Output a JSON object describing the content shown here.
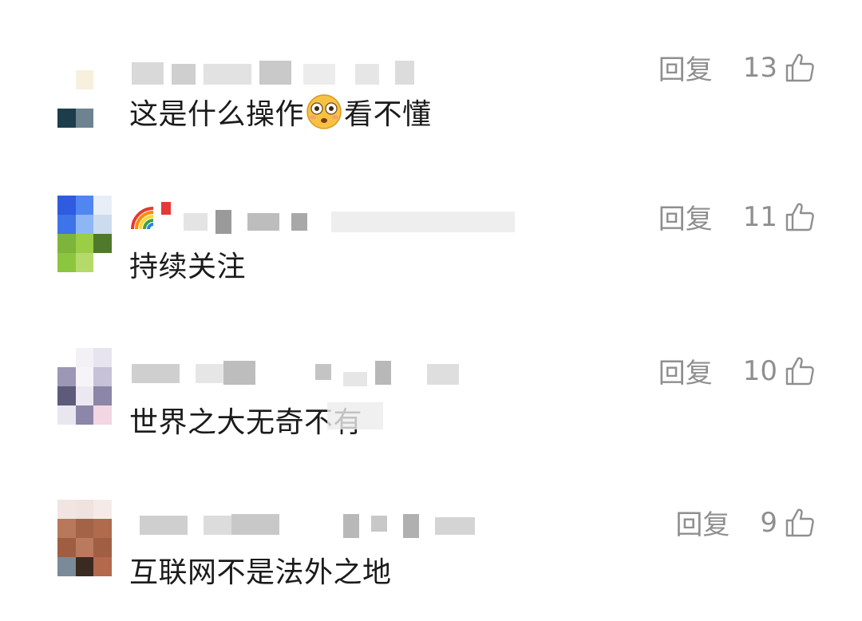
{
  "comments": [
    {
      "text_before": "这是什么操作",
      "emoji": "flushed-face-emoji",
      "text_after": "看不懂",
      "reply_label": "回复",
      "likes": "13"
    },
    {
      "text_before": "持续关注",
      "emoji": "",
      "text_after": "",
      "reply_label": "回复",
      "likes": "11"
    },
    {
      "text_before": "世界之大无奇不有",
      "emoji": "",
      "text_after": "",
      "reply_label": "回复",
      "likes": "10"
    },
    {
      "text_before": "互联网不是法外之地",
      "emoji": "",
      "text_after": "",
      "reply_label": "回复",
      "likes": "9"
    }
  ],
  "icons": {
    "like": "thumbs-up-icon",
    "rainbow": "rainbow-flag-icon"
  },
  "colors": {
    "text": "#1b1b1b",
    "meta": "#8f8f8f",
    "background": "#ffffff"
  }
}
